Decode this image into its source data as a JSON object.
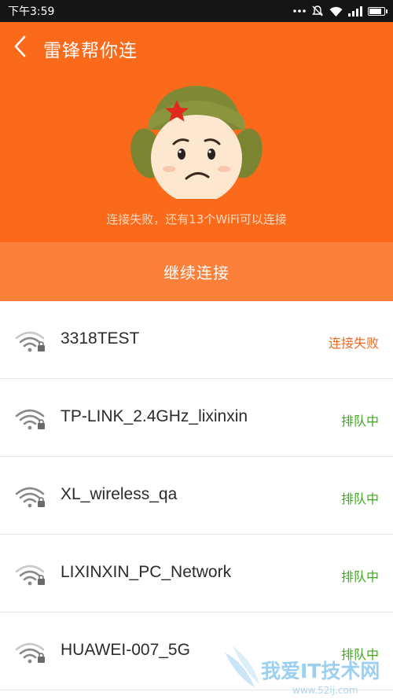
{
  "status_bar": {
    "time": "下午3:59",
    "battery_level": 0.9,
    "icons": [
      "more-dots-icon",
      "mute-icon",
      "wifi-signal-icon",
      "cell-signal-icon",
      "battery-icon"
    ]
  },
  "header": {
    "title": "雷锋帮你连",
    "message": "连接失败，还有13个WiFi可以连接",
    "background_color": "#fa6a1a",
    "mascot": "sad-soldier-mascot"
  },
  "continue_button": {
    "label": "继续连接",
    "color": "#fb8039"
  },
  "wifi_list": [
    {
      "name": "3318TEST",
      "status": "连接失败",
      "status_color": "#f06b22",
      "signal_level": 3,
      "locked": true
    },
    {
      "name": "TP-LINK_2.4GHz_lixinxin",
      "status": "排队中",
      "status_color": "#3fa91c",
      "signal_level": 4,
      "locked": true
    },
    {
      "name": "XL_wireless_qa",
      "status": "排队中",
      "status_color": "#3fa91c",
      "signal_level": 4,
      "locked": true
    },
    {
      "name": "LIXINXIN_PC_Network",
      "status": "排队中",
      "status_color": "#3fa91c",
      "signal_level": 3,
      "locked": true
    },
    {
      "name": "HUAWEI-007_5G",
      "status": "排队中",
      "status_color": "#3fa91c",
      "signal_level": 3,
      "locked": true
    }
  ],
  "watermark": {
    "text": "我爱IT技术网",
    "url": "www.52ij.com"
  }
}
